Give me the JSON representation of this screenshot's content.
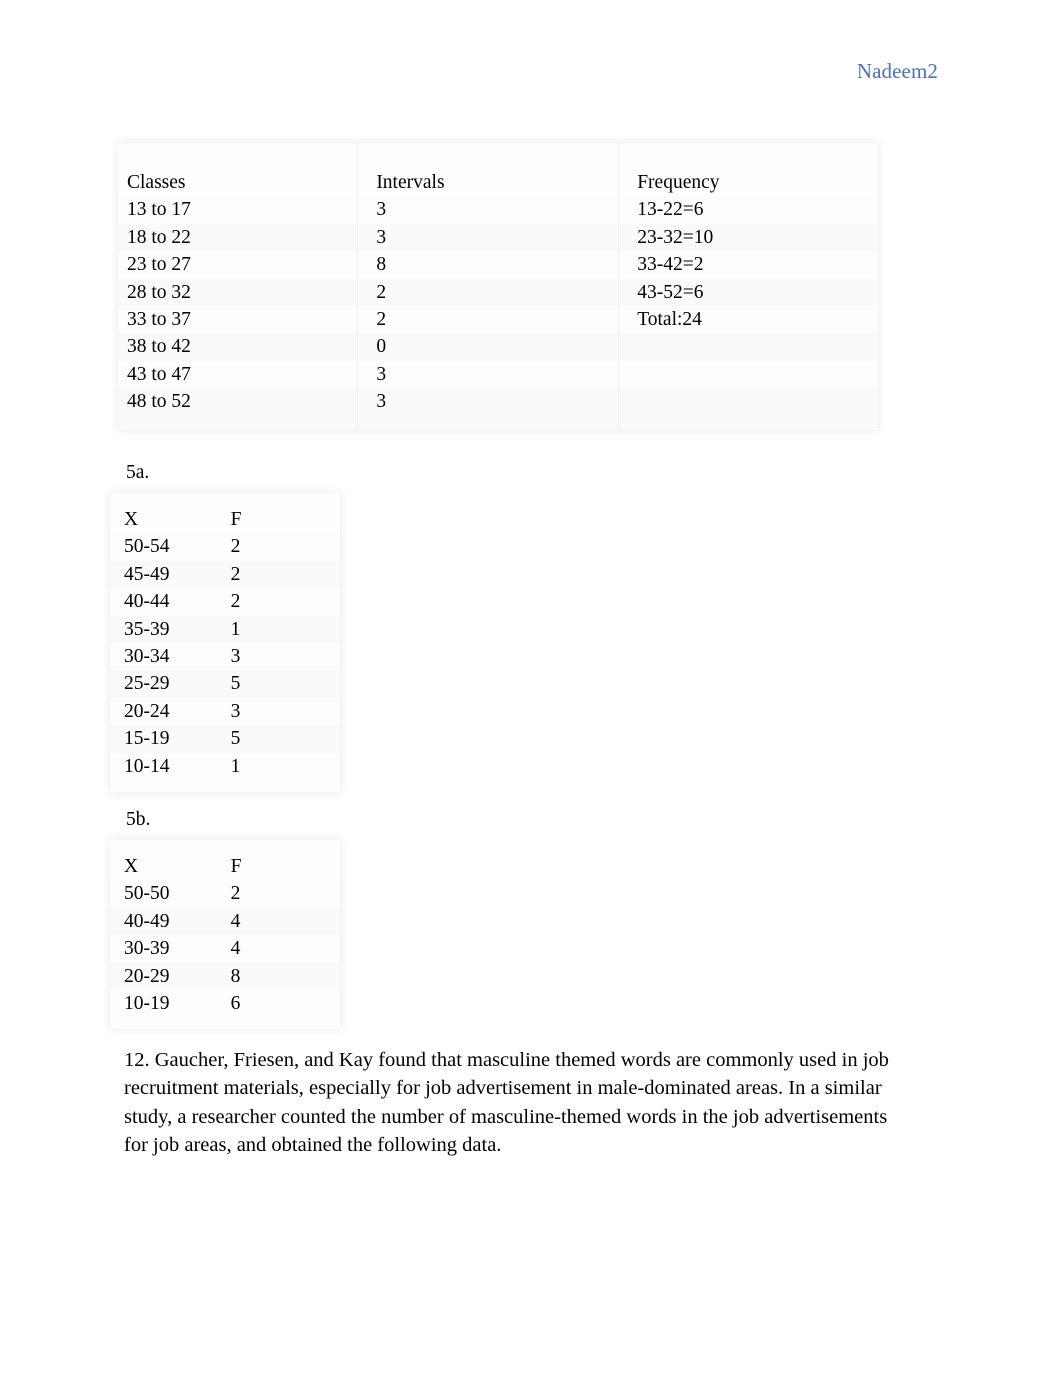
{
  "header": {
    "text": "Nadeem2",
    "color": "#4472C4"
  },
  "tables": {
    "classes_table": {
      "columns": [
        "Classes",
        "Intervals",
        "Frequency"
      ],
      "rows": [
        {
          "classes": "13 to 17",
          "intervals": "3",
          "frequency": "13-22=6"
        },
        {
          "classes": "18 to 22",
          "intervals": "3",
          "frequency": "23-32=10"
        },
        {
          "classes": "23 to 27",
          "intervals": "8",
          "frequency": "33-42=2"
        },
        {
          "classes": "28 to 32",
          "intervals": "2",
          "frequency": "43-52=6"
        },
        {
          "classes": "33 to 37",
          "intervals": "2",
          "frequency": "Total:24"
        },
        {
          "classes": "38 to 42",
          "intervals": "0",
          "frequency": ""
        },
        {
          "classes": "43 to 47",
          "intervals": "3",
          "frequency": ""
        },
        {
          "classes": "48 to 52",
          "intervals": "3",
          "frequency": ""
        }
      ]
    },
    "table_5a": {
      "label": "5a.",
      "columns": [
        "X",
        "F"
      ],
      "rows": [
        {
          "x": "50-54",
          "f": "2"
        },
        {
          "x": "45-49",
          "f": "2"
        },
        {
          "x": "40-44",
          "f": "2"
        },
        {
          "x": "35-39",
          "f": "1"
        },
        {
          "x": "30-34",
          "f": "3"
        },
        {
          "x": "25-29",
          "f": "5"
        },
        {
          "x": "20-24",
          "f": "3"
        },
        {
          "x": "15-19",
          "f": "5"
        },
        {
          "x": "10-14",
          "f": "1"
        }
      ]
    },
    "table_5b": {
      "label": "5b.",
      "columns": [
        "X",
        "F"
      ],
      "rows": [
        {
          "x": "50-50",
          "f": "2"
        },
        {
          "x": "40-49",
          "f": "4"
        },
        {
          "x": "30-39",
          "f": "4"
        },
        {
          "x": "20-29",
          "f": "8"
        },
        {
          "x": "10-19",
          "f": "6"
        }
      ]
    }
  },
  "body": {
    "paragraph_12": "12. Gaucher, Friesen, and Kay found that masculine themed words are commonly used in job recruitment materials, especially for job advertisement in male-dominated areas. In a similar study, a researcher counted the number of masculine-themed words in the job advertisements for job areas, and obtained the following data."
  }
}
